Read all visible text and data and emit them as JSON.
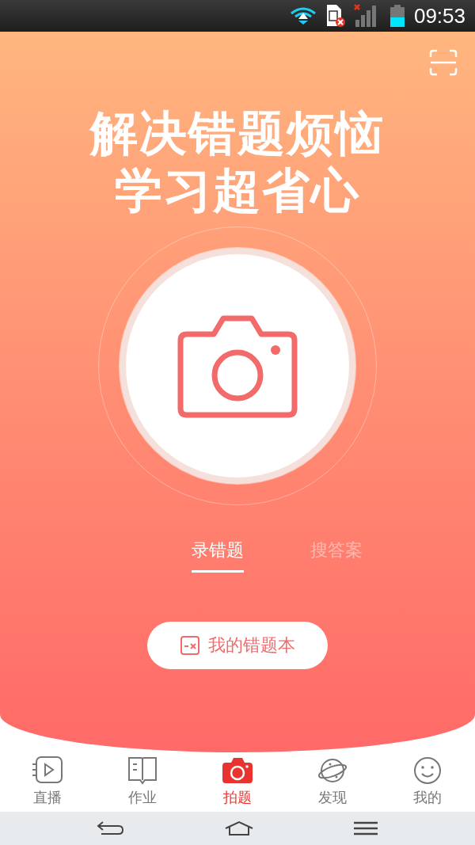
{
  "status_bar": {
    "time": "09:53"
  },
  "headline": [
    "解决错题烦恼",
    "学习超省心"
  ],
  "mode_tabs": [
    {
      "label": "录错题",
      "selected": true
    },
    {
      "label": "搜答案",
      "selected": false
    }
  ],
  "notebook_button": {
    "label": "我的错题本"
  },
  "bottom_tabs": [
    {
      "label": "直播",
      "kind": "live",
      "selected": false
    },
    {
      "label": "作业",
      "kind": "book",
      "selected": false
    },
    {
      "label": "拍题",
      "kind": "camera",
      "selected": true
    },
    {
      "label": "发现",
      "kind": "planet",
      "selected": false
    },
    {
      "label": "我的",
      "kind": "face",
      "selected": false
    }
  ]
}
